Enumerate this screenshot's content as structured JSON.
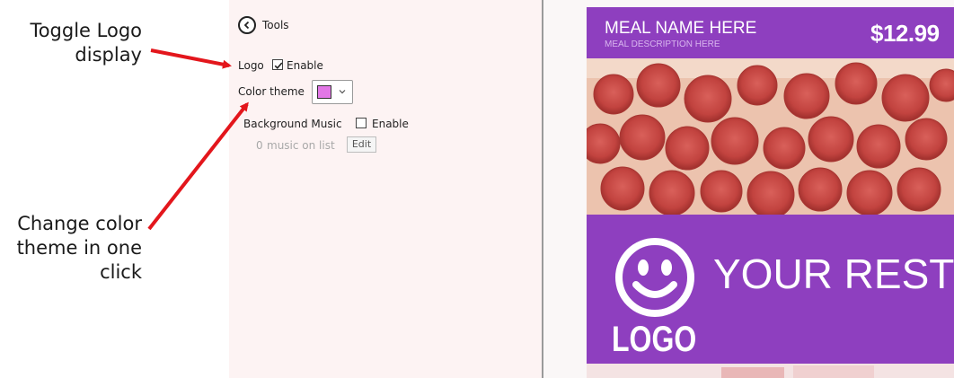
{
  "callouts": {
    "top": "Toggle Logo display",
    "bottom": "Change color theme in one click"
  },
  "tools": {
    "title": "Tools",
    "logo_label": "Logo",
    "logo_enable_label": "Enable",
    "logo_enabled": true,
    "color_theme_label": "Color theme",
    "color_theme_value": "#e277e6",
    "bg_music_label": "Background Music",
    "bg_music_enable_label": "Enable",
    "bg_music_enabled": false,
    "music_count": "0",
    "music_on_list_label": "music on list",
    "edit_label": "Edit"
  },
  "preview": {
    "meal_name": "MEAL NAME HERE",
    "meal_description": "MEAL DESCRIPTION HERE",
    "price": "$12.99",
    "restaurant_name": "YOUR REST",
    "logo_text": "LOGO",
    "accent_color": "#8e3fbf"
  },
  "icons": {
    "back": "back-arrow-icon",
    "checkmark": "checkmark-icon",
    "chevron": "chevron-down-icon",
    "smiley": "smiley-logo-icon",
    "arrow": "red-arrow-annotation"
  },
  "colors": {
    "annotation_red": "#e3161c",
    "panel_bg": "#fdf3f3"
  }
}
